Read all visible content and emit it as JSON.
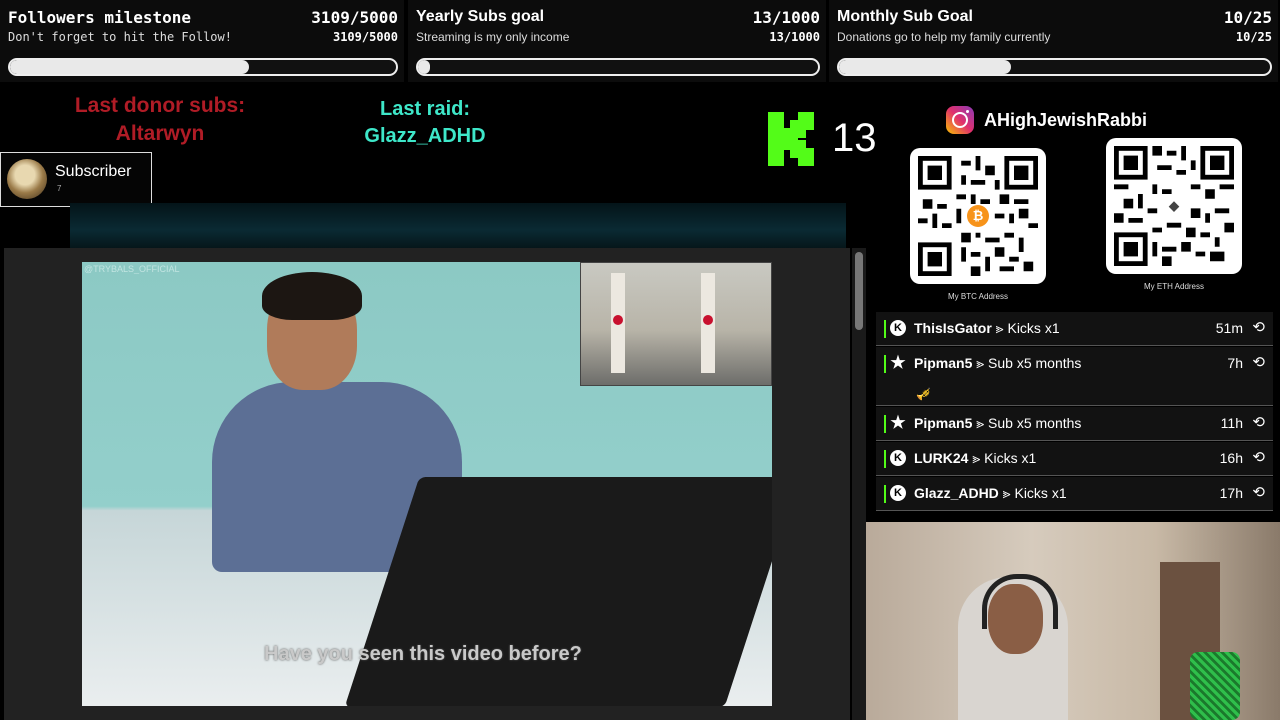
{
  "goals": [
    {
      "title": "Followers milestone",
      "count": "3109/5000",
      "subtitle": "Don't forget to hit the Follow!",
      "subcount": "3109/5000",
      "progress": 0.62
    },
    {
      "title": "Yearly Subs goal",
      "count": "13/1000",
      "subtitle": "Streaming is my only income",
      "subcount": "13/1000",
      "progress": 0.013
    },
    {
      "title": "Monthly Sub Goal",
      "count": "10/25",
      "subtitle": "Donations go to help my family currently",
      "subcount": "10/25",
      "progress": 0.4
    }
  ],
  "alerts": {
    "donor_label": "Last donor subs:",
    "donor_name": "Altarwyn",
    "raid_label": "Last raid:",
    "raid_name": "Glazz_ADHD"
  },
  "subscriber_card": {
    "label": "Subscriber",
    "count": "7"
  },
  "kick": {
    "icon": "kick-logo-icon",
    "count": "13",
    "color": "#53fc18"
  },
  "social": {
    "icon": "instagram-icon",
    "handle": "AHighJewishRabbi"
  },
  "qr": {
    "btc_label": "My BTC Address",
    "eth_label": "My ETH Address"
  },
  "video": {
    "watermark": "@TRYBALS_OFFICIAL",
    "caption": "Have you seen this video before?"
  },
  "events": [
    {
      "icon": "K",
      "user": "ThisIsGator",
      "action": "Kicks x1",
      "time": "51m"
    },
    {
      "icon": "★",
      "user": "Pipman5",
      "action": "Sub x5 months",
      "time": "7h",
      "extra": "🎺"
    },
    {
      "icon": "★",
      "user": "Pipman5",
      "action": "Sub x5 months",
      "time": "11h"
    },
    {
      "icon": "K",
      "user": "LURK24",
      "action": "Kicks x1",
      "time": "16h"
    },
    {
      "icon": "K",
      "user": "Glazz_ADHD",
      "action": "Kicks x1",
      "time": "17h"
    }
  ],
  "colors": {
    "accent": "#53fc18",
    "donor": "#b01c26",
    "raid": "#3ee7c9"
  }
}
